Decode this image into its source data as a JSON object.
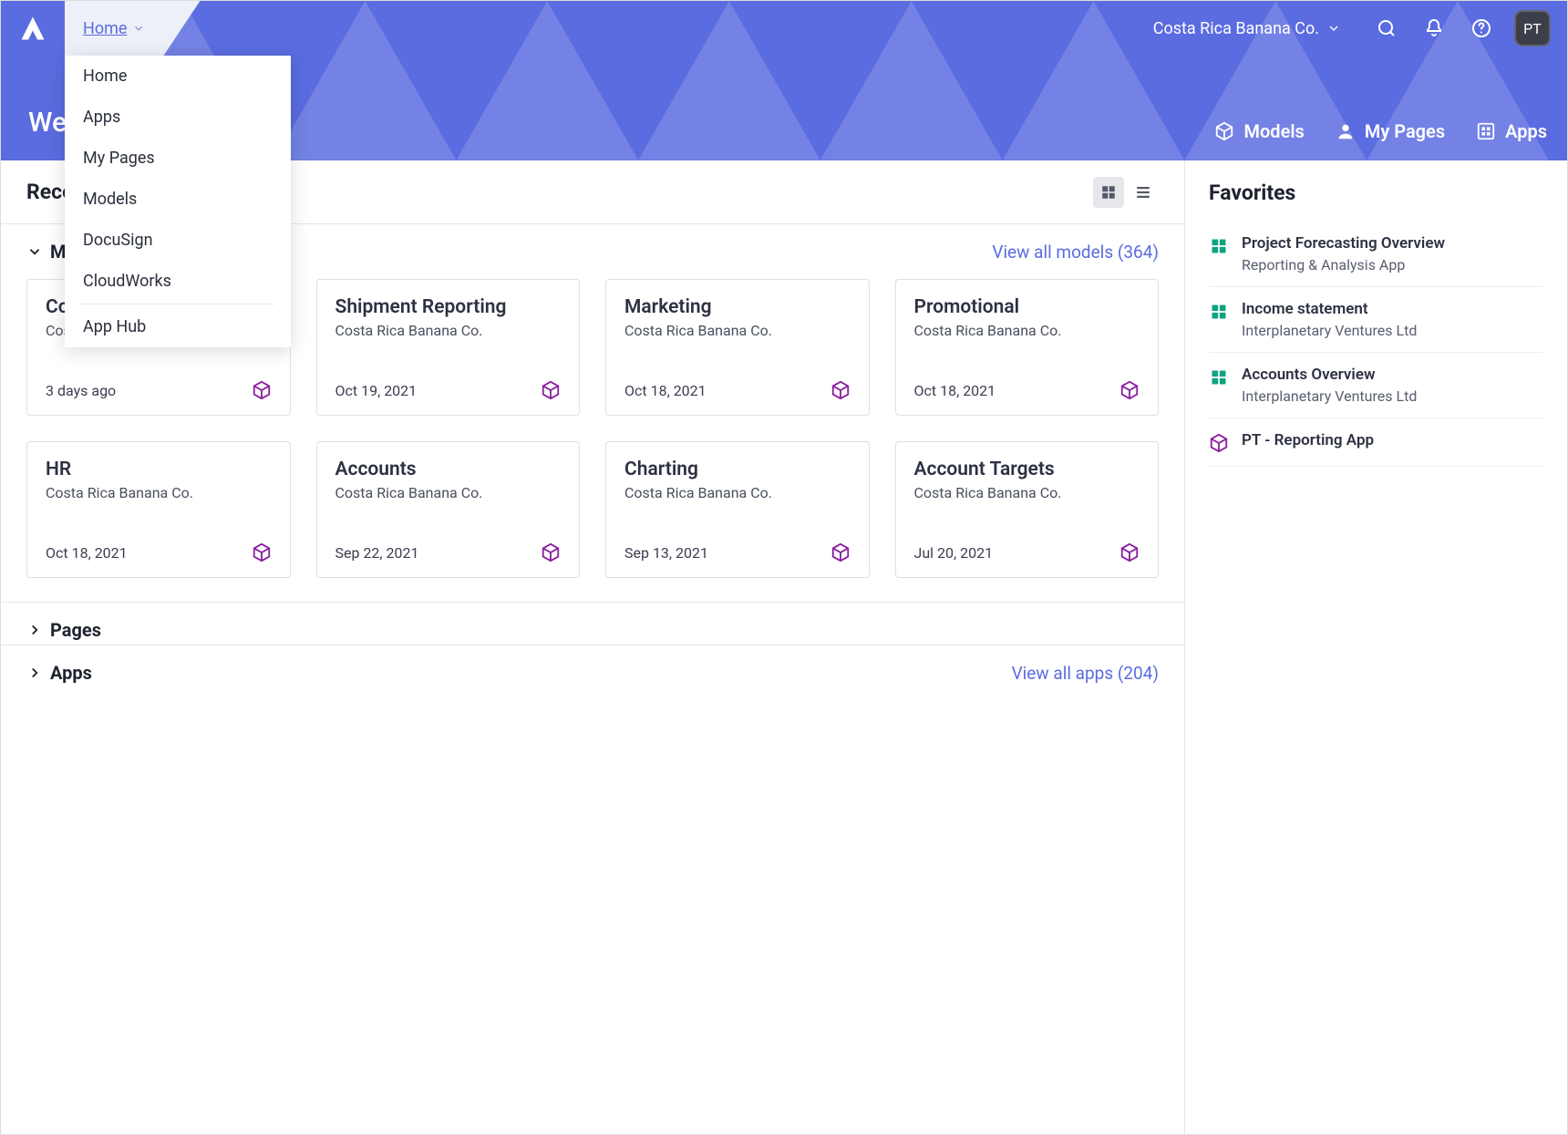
{
  "header": {
    "breadcrumb_label": "Home",
    "workspace_name": "Costa Rica Banana Co.",
    "avatar_initials": "PT",
    "welcome": "Welcome",
    "tabs": [
      {
        "label": "Models"
      },
      {
        "label": "My Pages"
      },
      {
        "label": "Apps"
      }
    ]
  },
  "dropdown": {
    "items_top": [
      {
        "label": "Home"
      },
      {
        "label": "Apps"
      },
      {
        "label": "My Pages"
      },
      {
        "label": "Models"
      },
      {
        "label": "DocuSign"
      },
      {
        "label": "CloudWorks"
      }
    ],
    "items_bottom": [
      {
        "label": "App Hub"
      }
    ]
  },
  "main": {
    "recent_header": "Recent",
    "sections": {
      "models": {
        "title": "Models",
        "view_all": "View all models (364)",
        "cards": [
          {
            "title": "Costa Rica Banana",
            "subtitle": "Costa Rica Banana Co.",
            "date": "3 days ago",
            "starred": true
          },
          {
            "title": "Shipment Reporting",
            "subtitle": "Costa Rica Banana Co.",
            "date": "Oct 19, 2021",
            "starred": false
          },
          {
            "title": "Marketing",
            "subtitle": "Costa Rica Banana Co.",
            "date": "Oct 18, 2021",
            "starred": false
          },
          {
            "title": "Promotional",
            "subtitle": "Costa Rica Banana Co.",
            "date": "Oct 18, 2021",
            "starred": false
          },
          {
            "title": "HR",
            "subtitle": "Costa Rica Banana Co.",
            "date": "Oct 18, 2021",
            "starred": false
          },
          {
            "title": "Accounts",
            "subtitle": "Costa Rica Banana Co.",
            "date": "Sep 22, 2021",
            "starred": false
          },
          {
            "title": "Charting",
            "subtitle": "Costa Rica Banana Co.",
            "date": "Sep 13, 2021",
            "starred": false
          },
          {
            "title": "Account Targets",
            "subtitle": "Costa Rica Banana Co.",
            "date": "Jul 20, 2021",
            "starred": false
          }
        ]
      },
      "pages": {
        "title": "Pages"
      },
      "apps": {
        "title": "Apps",
        "view_all": "View all apps (204)"
      }
    }
  },
  "favorites": {
    "title": "Favorites",
    "items": [
      {
        "icon": "app-green",
        "title": "Project Forecasting Overview",
        "subtitle": "Reporting & Analysis App"
      },
      {
        "icon": "app-green",
        "title": "Income statement",
        "subtitle": "Interplanetary Ventures Ltd"
      },
      {
        "icon": "app-green",
        "title": "Accounts Overview",
        "subtitle": "Interplanetary Ventures Ltd"
      },
      {
        "icon": "model-purple",
        "title": "PT - Reporting App",
        "subtitle": ""
      }
    ]
  }
}
